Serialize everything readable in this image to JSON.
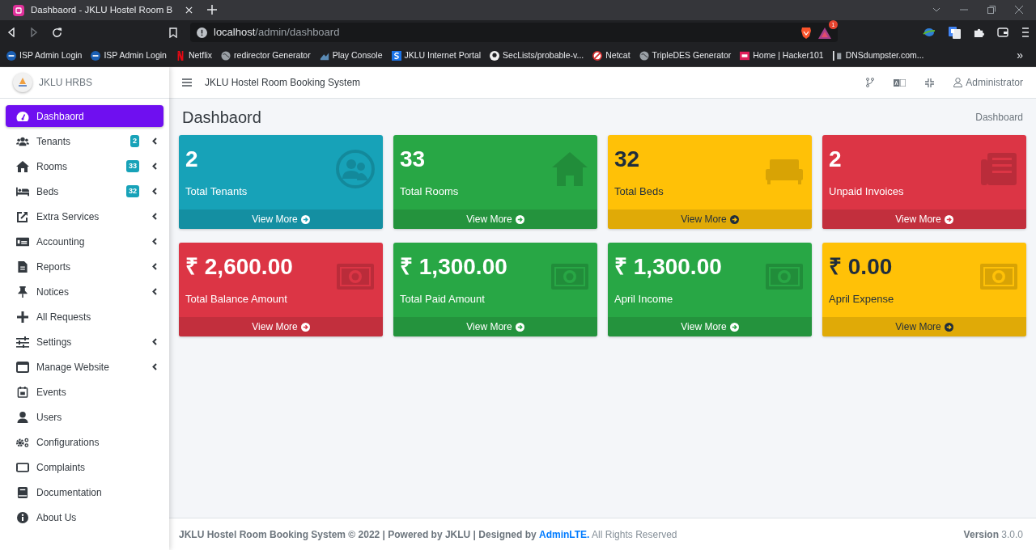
{
  "browser": {
    "tab_title": "Dashbaord - JKLU Hostel Room B",
    "url_host": "localhost",
    "url_path": "/admin/dashboard",
    "shields_count": "1",
    "bookmarks": [
      {
        "label": "ISP Admin Login"
      },
      {
        "label": "ISP Admin Login"
      },
      {
        "label": "Netflix"
      },
      {
        "label": "redirector Generator"
      },
      {
        "label": "Play Console"
      },
      {
        "label": "JKLU Internet Portal"
      },
      {
        "label": "SecLists/probable-v..."
      },
      {
        "label": "Netcat"
      },
      {
        "label": "TripleDES Generator"
      },
      {
        "label": "Home | Hacker101"
      },
      {
        "label": "DNSdumpster.com..."
      }
    ],
    "overflow": "»"
  },
  "sidebar": {
    "brand": "JKLU HRBS",
    "items": [
      {
        "label": "Dashbaord",
        "selected": true,
        "submenu": false
      },
      {
        "label": "Tenants",
        "badge": "2",
        "selected": false,
        "submenu": true
      },
      {
        "label": "Rooms",
        "badge": "33",
        "selected": false,
        "submenu": true
      },
      {
        "label": "Beds",
        "badge": "32",
        "selected": false,
        "submenu": true
      },
      {
        "label": "Extra Services",
        "selected": false,
        "submenu": true
      },
      {
        "label": "Accounting",
        "selected": false,
        "submenu": true
      },
      {
        "label": "Reports",
        "selected": false,
        "submenu": true
      },
      {
        "label": "Notices",
        "selected": false,
        "submenu": true
      },
      {
        "label": "All Requests",
        "selected": false,
        "submenu": false
      },
      {
        "label": "Settings",
        "selected": false,
        "submenu": true
      },
      {
        "label": "Manage Website",
        "selected": false,
        "submenu": true
      },
      {
        "label": "Events",
        "selected": false,
        "submenu": false
      },
      {
        "label": "Users",
        "selected": false,
        "submenu": false
      },
      {
        "label": "Configurations",
        "selected": false,
        "submenu": false
      },
      {
        "label": "Complaints",
        "selected": false,
        "submenu": false
      },
      {
        "label": "Documentation",
        "selected": false,
        "submenu": false
      },
      {
        "label": "About Us",
        "selected": false,
        "submenu": false
      }
    ]
  },
  "navbar": {
    "title": "JKLU Hostel Room Booking System",
    "user": "Administrator"
  },
  "page": {
    "title": "Dashbaord",
    "breadcrumb": "Dashboard"
  },
  "cards": [
    {
      "value": "2",
      "label": "Total Tenants",
      "link": "View More",
      "kind": "info"
    },
    {
      "value": "33",
      "label": "Total Rooms",
      "link": "View More",
      "kind": "success"
    },
    {
      "value": "32",
      "label": "Total Beds",
      "link": "View More",
      "kind": "warning"
    },
    {
      "value": "2",
      "label": "Unpaid Invoices",
      "link": "View More",
      "kind": "danger"
    },
    {
      "value": "₹ 2,600.00",
      "label": "Total Balance Amount",
      "link": "View More",
      "kind": "danger"
    },
    {
      "value": "₹ 1,300.00",
      "label": "Total Paid Amount",
      "link": "View More",
      "kind": "success"
    },
    {
      "value": "₹ 1,300.00",
      "label": "April Income",
      "link": "View More",
      "kind": "success"
    },
    {
      "value": "₹ 0.00",
      "label": "April Expense",
      "link": "View More",
      "kind": "warning"
    }
  ],
  "footer": {
    "credit": "**JKLU Hostel Room Booking System © 2022 | Powered by JKLU | Designed by** ",
    "link": "AdminLTE.",
    "rights": " All Rights Reserved",
    "version_label": "Version",
    "version": "3.0.0"
  }
}
